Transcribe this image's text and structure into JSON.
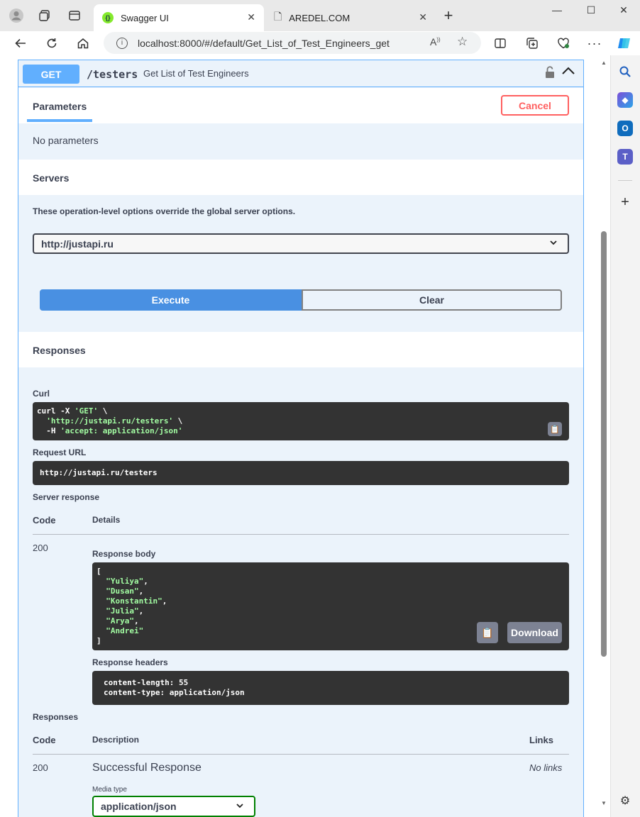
{
  "browser": {
    "tabs": [
      {
        "title": "Swagger UI",
        "active": true
      },
      {
        "title": "AREDEL.COM",
        "active": false
      }
    ],
    "url": "localhost:8000/#/default/Get_List_of_Test_Engineers_get"
  },
  "operation": {
    "method": "GET",
    "path": "/testers",
    "description": "Get List of Test Engineers"
  },
  "parameters": {
    "title": "Parameters",
    "cancel_label": "Cancel",
    "empty_text": "No parameters"
  },
  "servers": {
    "title": "Servers",
    "note": "These operation-level options override the global server options.",
    "selected": "http://justapi.ru"
  },
  "actions": {
    "execute": "Execute",
    "clear": "Clear"
  },
  "responses_section": {
    "title": "Responses",
    "curl_label": "Curl",
    "curl_lines": [
      "curl -X ",
      "'GET'",
      " \\",
      "'http://justapi.ru/testers'",
      " \\",
      "-H ",
      "'accept: application/json'"
    ],
    "request_url_label": "Request URL",
    "request_url": "http://justapi.ru/testers",
    "server_response_label": "Server response",
    "code_header": "Code",
    "details_header": "Details",
    "code": "200",
    "response_body_label": "Response body",
    "response_body": [
      "Yuliya",
      "Dusan",
      "Konstantin",
      "Julia",
      "Arya",
      "Andrei"
    ],
    "download_label": "Download",
    "response_headers_label": "Response headers",
    "response_headers": [
      "content-length: 55",
      "content-type: application/json"
    ]
  },
  "documented": {
    "title": "Responses",
    "code_header": "Code",
    "description_header": "Description",
    "links_header": "Links",
    "code": "200",
    "description": "Successful Response",
    "links": "No links",
    "media_type_label": "Media type",
    "media_type": "application/json"
  },
  "colors": {
    "get": "#61affe",
    "execute": "#4990e2",
    "cancel": "#ff6060",
    "code_bg": "#333333",
    "string": "#a2fca2"
  }
}
